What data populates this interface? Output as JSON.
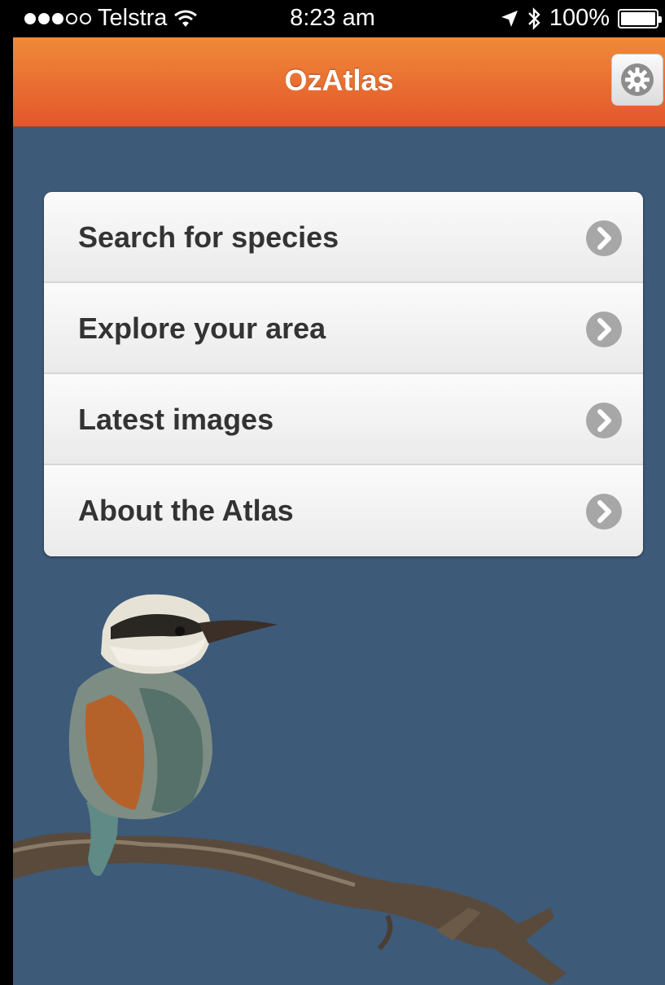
{
  "status_bar": {
    "carrier": "Telstra",
    "time": "8:23 am",
    "battery": "100%",
    "signal_bars_filled": 3,
    "signal_bars_total": 5
  },
  "nav": {
    "title": "OzAtlas",
    "settings_icon": "gear-icon"
  },
  "menu": {
    "items": [
      {
        "label": "Search for species",
        "icon": "chevron-right-icon"
      },
      {
        "label": "Explore your area",
        "icon": "chevron-right-icon"
      },
      {
        "label": "Latest images",
        "icon": "chevron-right-icon"
      },
      {
        "label": "About the Atlas",
        "icon": "chevron-right-icon"
      }
    ]
  },
  "colors": {
    "background": "#3d5a79",
    "nav_top": "#f08a38",
    "nav_bottom": "#e3562c",
    "menu_text": "#333333"
  }
}
